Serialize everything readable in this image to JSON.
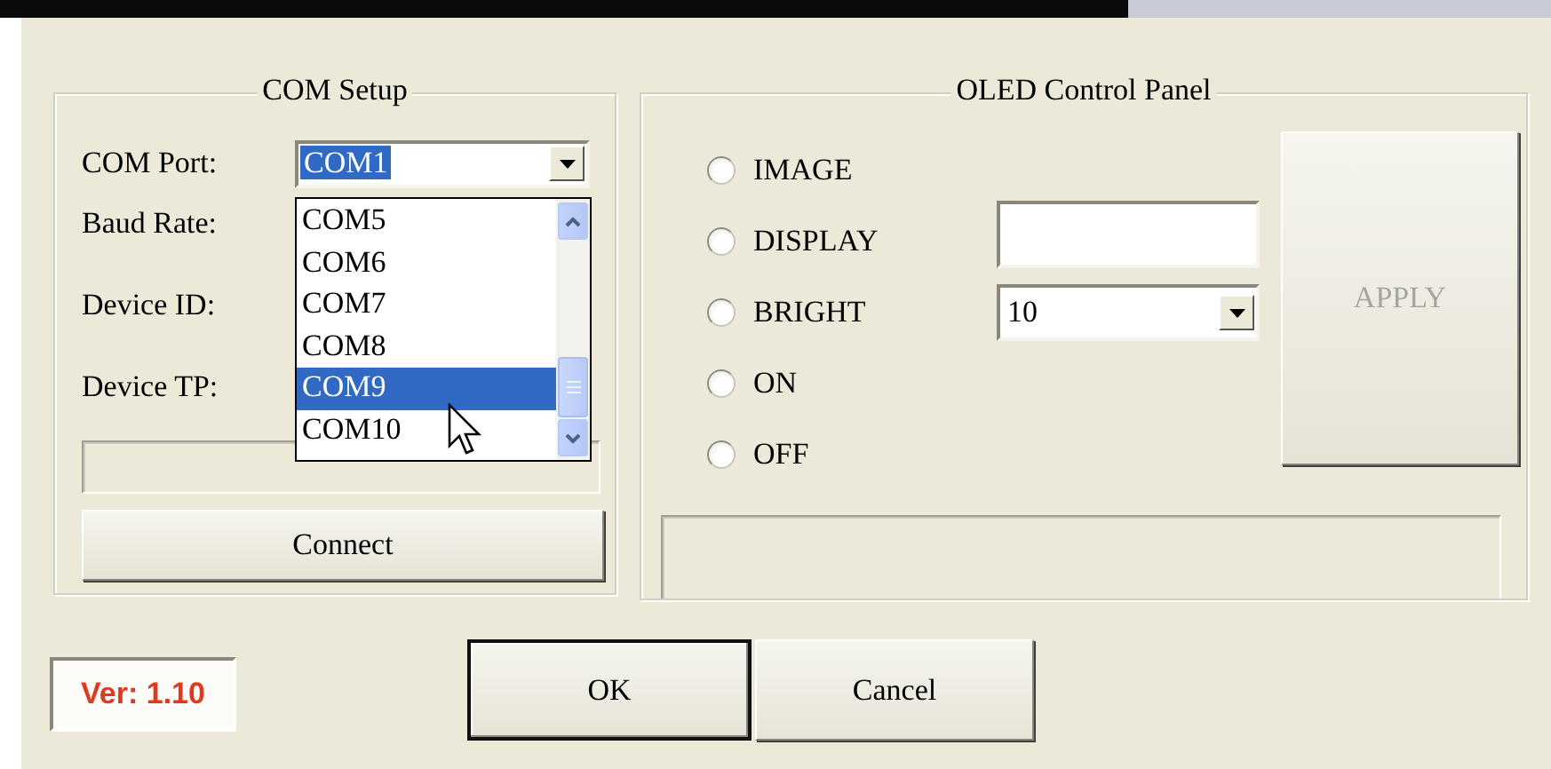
{
  "com_setup": {
    "title": "COM Setup",
    "fields": [
      {
        "label": "COM Port:"
      },
      {
        "label": "Baud Rate:"
      },
      {
        "label": "Device ID:"
      },
      {
        "label": "Device TP:"
      }
    ],
    "com_port": {
      "value": "COM1",
      "list": [
        {
          "label": "COM5",
          "selected": false
        },
        {
          "label": "COM6",
          "selected": false
        },
        {
          "label": "COM7",
          "selected": false
        },
        {
          "label": "COM8",
          "selected": false
        },
        {
          "label": "COM9",
          "selected": true
        },
        {
          "label": "COM10",
          "selected": false
        }
      ]
    },
    "connect_button": "Connect"
  },
  "oled": {
    "title": "OLED Control Panel",
    "options": [
      {
        "label": "IMAGE",
        "selected": false
      },
      {
        "label": "DISPLAY",
        "selected": false
      },
      {
        "label": "BRIGHT",
        "selected": false
      },
      {
        "label": "ON",
        "selected": false
      },
      {
        "label": "OFF",
        "selected": false
      }
    ],
    "bright_value": "10",
    "apply_button": {
      "label": "APPLY",
      "disabled": true
    }
  },
  "version": "Ver: 1.10",
  "buttons": [
    {
      "label": "OK",
      "default": true
    },
    {
      "label": "Cancel",
      "default": false
    }
  ]
}
